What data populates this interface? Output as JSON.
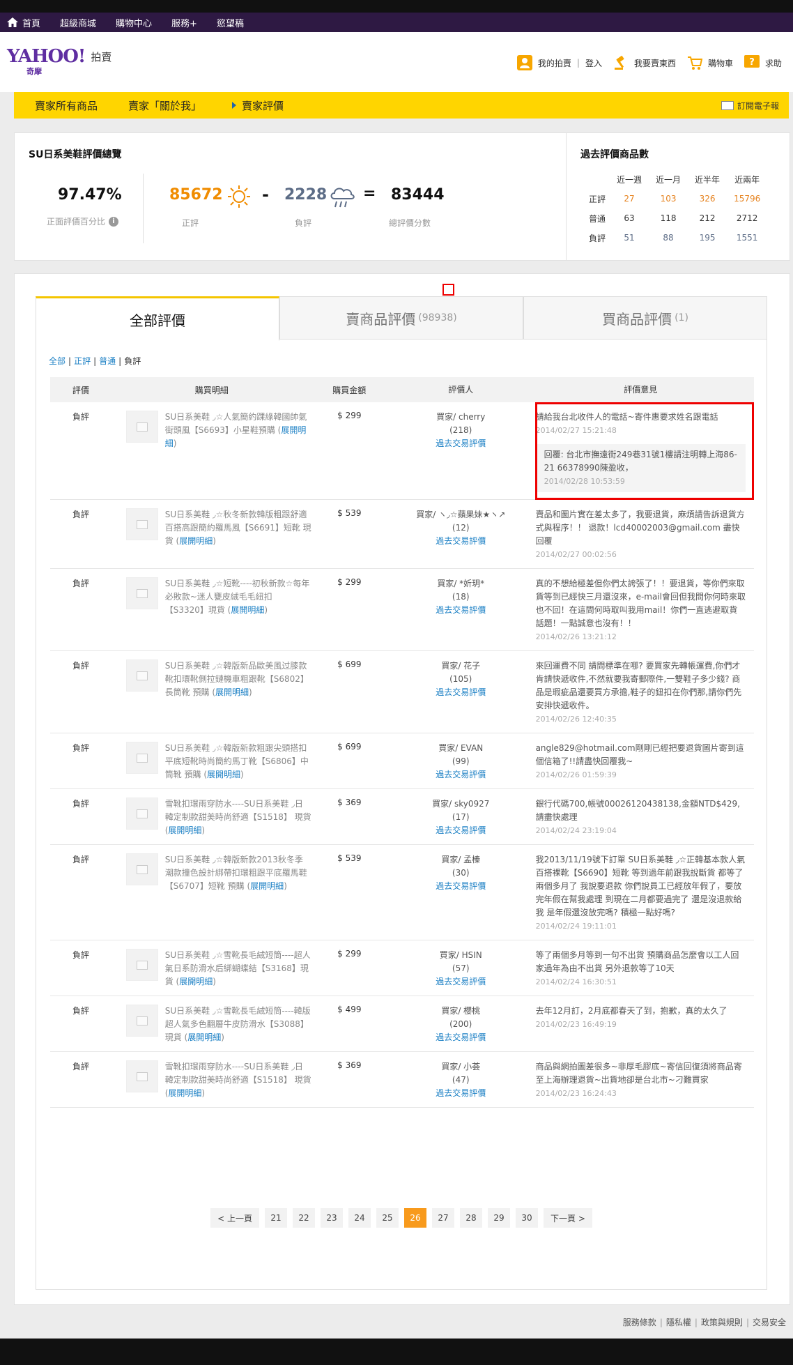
{
  "topnav": {
    "items": [
      "首頁",
      "超級商城",
      "購物中心",
      "服務+",
      "慾望稿"
    ]
  },
  "header": {
    "logo_text": "YAHOO!",
    "logo_sub": "奇摩",
    "service": "拍賣",
    "links": {
      "my_auction": "我的拍賣",
      "login": "登入",
      "sell": "我要賣東西",
      "cart": "購物車",
      "help": "求助"
    }
  },
  "sellerbar": {
    "all_items": "賣家所有商品",
    "about": "賣家「關於我」",
    "ratings": "賣家評價",
    "subscribe": "訂閱電子報"
  },
  "summary": {
    "title": "SU日系美鞋評價總覽",
    "percent": "97.47%",
    "percent_label": "正面評價百分比",
    "positive": "85672",
    "positive_label": "正評",
    "minus": "-",
    "negative": "2228",
    "negative_label": "負評",
    "equals": "=",
    "total": "83444",
    "total_label": "總評價分數",
    "colors": {
      "positive": "#f08c00",
      "negative": "#5c6c86"
    }
  },
  "past": {
    "title": "過去評價商品數",
    "headers": [
      "近一週",
      "近一月",
      "近半年",
      "近兩年"
    ],
    "rows": [
      {
        "label": "正評",
        "values": [
          "27",
          "103",
          "326",
          "15796"
        ]
      },
      {
        "label": "普通",
        "values": [
          "63",
          "118",
          "212",
          "2712"
        ]
      },
      {
        "label": "負評",
        "values": [
          "51",
          "88",
          "195",
          "1551"
        ]
      }
    ]
  },
  "tabs": [
    {
      "label": "全部評價",
      "count": ""
    },
    {
      "label": "賣商品評價",
      "count": "(98938)"
    },
    {
      "label": "買商品評價",
      "count": "(1)"
    }
  ],
  "filter": {
    "all": "全部",
    "pos": "正評",
    "norm": "普通",
    "neg": "負評"
  },
  "table": {
    "headers": [
      "評價",
      "購買明細",
      "購買金額",
      "評價人",
      "評價意見"
    ],
    "detail_link": "展開明細",
    "history_link": "過去交易評價",
    "rows": [
      {
        "type": "負評",
        "item": "SU日系美鞋 ◞☆人氣簡約踝綠韓國帥氣街頭風【S6693】小星鞋預購 (",
        "amount": "$ 299",
        "rater": "買家/ cherry",
        "rater_count": "(218)",
        "comment": "請給我台北收件人的電話~寄件惠要求姓名跟電話",
        "date": "2014/02/27 15:21:48",
        "reply": "回覆: 台北市撫遠街249巷31號1樓請注明轉上海86-21 66378990陳盈收，",
        "reply_date": "2014/02/28 10:53:59",
        "highlight": true
      },
      {
        "type": "負評",
        "item": "SU日系美鞋 ◞☆秋冬新款韓版粗跟舒適百搭高跟簡約羅馬風【S6691】短靴 現貨 (",
        "amount": "$ 539",
        "rater": "買家/ ヽ◞☆蘋果妹★ヽ↗",
        "rater_count": "(12)",
        "comment": "賣品和圖片實在差太多了，我要退貨，麻煩請告訴退貨方式與程序！！ 退款！lcd40002003@gmail.com 盡快回覆",
        "date": "2014/02/27 00:02:56"
      },
      {
        "type": "負評",
        "item": "SU日系美鞋 ◞☆短靴----初秋新款☆每年必敗款~迷人甕皮絨毛毛紐扣【S3320】現貨 (",
        "amount": "$ 299",
        "rater": "買家/ *妡玥*",
        "rater_count": "(18)",
        "comment": "真的不想給極差但你們太誇張了！！要退貨，等你們來取貨等到已經快三月還沒來，e-mail會回但我問你何時來取也不回！在這問何時取叫我用mail！你們一直逃避取貨話題！一點誠意也沒有！！",
        "date": "2014/02/26 13:21:12"
      },
      {
        "type": "負評",
        "item": "SU日系美鞋 ◞☆韓版新品歐美風过膝款靴扣環靴側拉鏈機車粗跟靴【S6802】長筒靴 預購 (",
        "amount": "$ 699",
        "rater": "買家/ 花子",
        "rater_count": "(105)",
        "comment": "來回運費不同 請問標準在哪? 要買家先轉帳運費,你們才肯請快遞收件,不然就要我寄郵際件,一雙鞋子多少錢? 商品是瑕疵品還要買方承擔,鞋子的鈕扣在你們那,請你們先安排快遞收件。",
        "date": "2014/02/26 12:40:35"
      },
      {
        "type": "負評",
        "item": "SU日系美鞋 ◞☆韓版新款粗跟尖頭搭扣平底短靴時尚簡約馬丁靴【S6806】中筒靴 預購 (",
        "amount": "$ 699",
        "rater": "買家/ EVAN",
        "rater_count": "(99)",
        "comment": "angle829@hotmail.com剛剛已經把要退貨圖片寄到這個信箱了!!請盡快回覆我~",
        "date": "2014/02/26 01:59:39"
      },
      {
        "type": "負評",
        "item": "雪靴扣環雨穿防水----SU日系美鞋 ◞日韓定制款甜美時尚舒適【S1518】 現貨 (",
        "amount": "$ 369",
        "rater": "買家/ sky0927",
        "rater_count": "(17)",
        "comment": "銀行代碼700,帳號00026120438138,金額NTD$429,請盡快處理",
        "date": "2014/02/24 23:19:04"
      },
      {
        "type": "負評",
        "item": "SU日系美鞋 ◞☆韓版新款2013秋冬季潮款撞色設計綁帶扣環粗跟平底羅馬鞋【S6707】短靴 預購 (",
        "amount": "$ 539",
        "rater": "買家/ 孟榛",
        "rater_count": "(30)",
        "comment": "我2013/11/19號下訂單 SU日系美鞋 ◞☆正韓基本款人氣百搭裸靴【S6690】短靴 等到過年前跟我說斷貨 都等了兩個多月了 我說要退款 你們說員工已經放年假了，要放完年假在幫我處理 到現在二月都要過完了 還是沒退款給我 是年假還沒放完嗎? 積極一點好嗎?",
        "date": "2014/02/24 19:11:01"
      },
      {
        "type": "負評",
        "item": "SU日系美鞋 ◞☆雪靴長毛絨短筒----超人氣日系防滑水后綁蝴蝶結【S3168】現貨 (",
        "amount": "$ 299",
        "rater": "買家/ HSIN",
        "rater_count": "(57)",
        "comment": "等了兩個多月等到一句不出貨 預購商品怎麼會以工人回家過年為由不出貨 另外退款等了10天",
        "date": "2014/02/24 16:30:51"
      },
      {
        "type": "負評",
        "item": "SU日系美鞋 ◞☆雪靴長毛絨短筒----韓版超人氣多色翻層牛皮防滑水【S3088】 現貨 (",
        "amount": "$ 499",
        "rater": "買家/ 櫻桃",
        "rater_count": "(200)",
        "comment": "去年12月訂，2月底都春天了到，抱歉，真的太久了",
        "date": "2014/02/23 16:49:19"
      },
      {
        "type": "負評",
        "item": "雪靴扣環雨穿防水----SU日系美鞋 ◞日韓定制款甜美時尚舒適【S1518】 現貨 (",
        "amount": "$ 369",
        "rater": "買家/ 小荟",
        "rater_count": "(47)",
        "comment": "商品與網拍圖差很多~非厚毛膠底~寄信回復須將商品寄至上海辦理退貨~出貨地卻是台北市~刁難買家",
        "date": "2014/02/23 16:24:43"
      }
    ]
  },
  "pager": {
    "prev": "< 上一頁",
    "pages": [
      "21",
      "22",
      "23",
      "24",
      "25",
      "26",
      "27",
      "28",
      "29",
      "30"
    ],
    "current": "26",
    "next": "下一頁 >"
  },
  "footer": {
    "links": [
      "服務條款",
      "隱私權",
      "政策與規則",
      "交易安全"
    ]
  }
}
